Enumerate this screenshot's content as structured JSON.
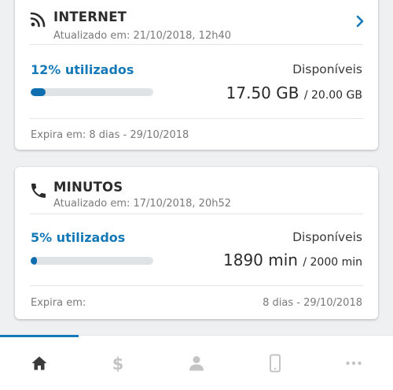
{
  "internet": {
    "title": "INTERNET",
    "updated": "Atualizado em: 21/10/2018, 12h40",
    "used_label": "12% utilizados",
    "used_percent": 12,
    "available_label": "Disponíveis",
    "available_value": "17.50 GB",
    "available_total": "/ 20.00 GB",
    "expires": "Expira em: 8 dias - 29/10/2018"
  },
  "minutes": {
    "title": "MINUTOS",
    "updated": "Atualizado em:  17/10/2018, 20h52",
    "used_label": "5% utilizados",
    "used_percent": 5,
    "available_label": "Disponíveis",
    "available_value": "1890 min",
    "available_total": "/ 2000 min",
    "expires_label": "Expira em:",
    "expires_date": "8 dias - 29/10/2018"
  },
  "nav": {
    "items": [
      "home-icon",
      "dollar-icon",
      "person-icon",
      "phone-icon",
      "more-icon"
    ],
    "active_index": 0
  },
  "colors": {
    "accent": "#1579b7",
    "bar_fill": "#0f6fae",
    "bar_track": "#dfe3e6",
    "nav_active": "#3a3a3a",
    "nav_inactive": "#c4c4c4"
  }
}
